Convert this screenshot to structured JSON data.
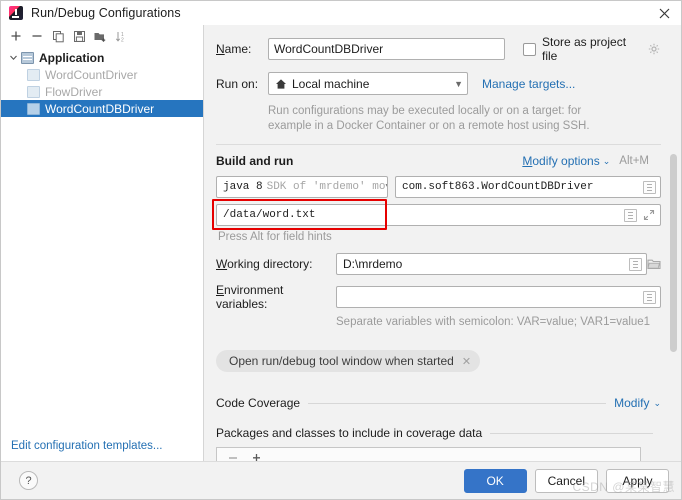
{
  "window": {
    "title": "Run/Debug Configurations",
    "app_icon": "intellij-idea-icon",
    "close_label": "×"
  },
  "sidebar": {
    "toolbar": [
      {
        "name": "add-configuration-button",
        "icon": "plus-icon",
        "label": "+"
      },
      {
        "name": "remove-configuration-button",
        "icon": "minus-icon",
        "label": "−"
      },
      {
        "name": "copy-configuration-button",
        "icon": "copy-icon",
        "label": "Copy"
      },
      {
        "name": "save-configuration-button",
        "icon": "save-icon",
        "label": "Save"
      },
      {
        "name": "move-into-folder-button",
        "icon": "folder-add-icon",
        "label": "Folder"
      },
      {
        "name": "sort-configurations-button",
        "icon": "sort-az-icon",
        "label": "Sort"
      }
    ],
    "tree": [
      {
        "label": "Application",
        "type": "group",
        "icon": "application-group-icon",
        "expanded": true,
        "selected": false
      },
      {
        "label": "WordCountDriver",
        "type": "child",
        "icon": "run-config-icon",
        "selected": false
      },
      {
        "label": "FlowDriver",
        "type": "child",
        "icon": "run-config-icon",
        "selected": false
      },
      {
        "label": "WordCountDBDriver",
        "type": "child",
        "icon": "run-config-icon",
        "selected": true
      }
    ],
    "edit_templates_link": "Edit configuration templates..."
  },
  "main": {
    "name_label": "Name:",
    "name_value": "WordCountDBDriver",
    "store_as_project_file_label": "Store as project file",
    "store_as_project_file_checked": false,
    "store_gear_icon": "gear-icon",
    "run_on_label": "Run on:",
    "run_on_value": "Local machine",
    "run_on_icon": "home-icon",
    "manage_targets_link": "Manage targets...",
    "run_on_hint_line1": "Run configurations may be executed locally or on a target: for",
    "run_on_hint_line2": "example in a Docker Container or on a remote host using SSH.",
    "build_and_run_title": "Build and run",
    "modify_options_link": "Modify options",
    "modify_options_shortcut": "Alt+M",
    "jdk_value_main": "java 8",
    "jdk_value_dim": "SDK of 'mrdemo' mo",
    "main_class_value": "com.soft863.WordCountDBDriver",
    "main_class_icon": "list-dropdown-icon",
    "program_args_value": "/data/word.txt",
    "program_args_icon": "list-dropdown-icon",
    "program_args_expand_icon": "expand-icon",
    "program_args_highlight_color": "#e60000",
    "press_alt_hint": "Press Alt for field hints",
    "working_directory_label": "Working directory:",
    "working_directory_value": "D:\\mrdemo",
    "working_directory_icon": "list-dropdown-icon",
    "working_directory_browse_icon": "folder-icon",
    "environment_variables_label": "Environment variables:",
    "environment_variables_value": "",
    "environment_variables_icon": "list-dropdown-icon",
    "environment_hint": "Separate variables with semicolon: VAR=value; VAR1=value1",
    "open_tool_window_chip": "Open run/debug tool window when started",
    "chip_remove_icon": "close-small-icon",
    "code_coverage_title": "Code Coverage",
    "code_coverage_modify_link": "Modify",
    "packages_classes_title": "Packages and classes to include in coverage data",
    "coverage_remove_icon": "minus-icon",
    "coverage_add_icon": "plus-icon"
  },
  "footer": {
    "help_label": "?",
    "ok_label": "OK",
    "cancel_label": "Cancel",
    "apply_label": "Apply",
    "watermark": "CSDN @某某智慧"
  },
  "colors": {
    "accent": "#3574c8",
    "link": "#2470b3",
    "selection": "#2675bf",
    "highlight": "#e60000"
  }
}
